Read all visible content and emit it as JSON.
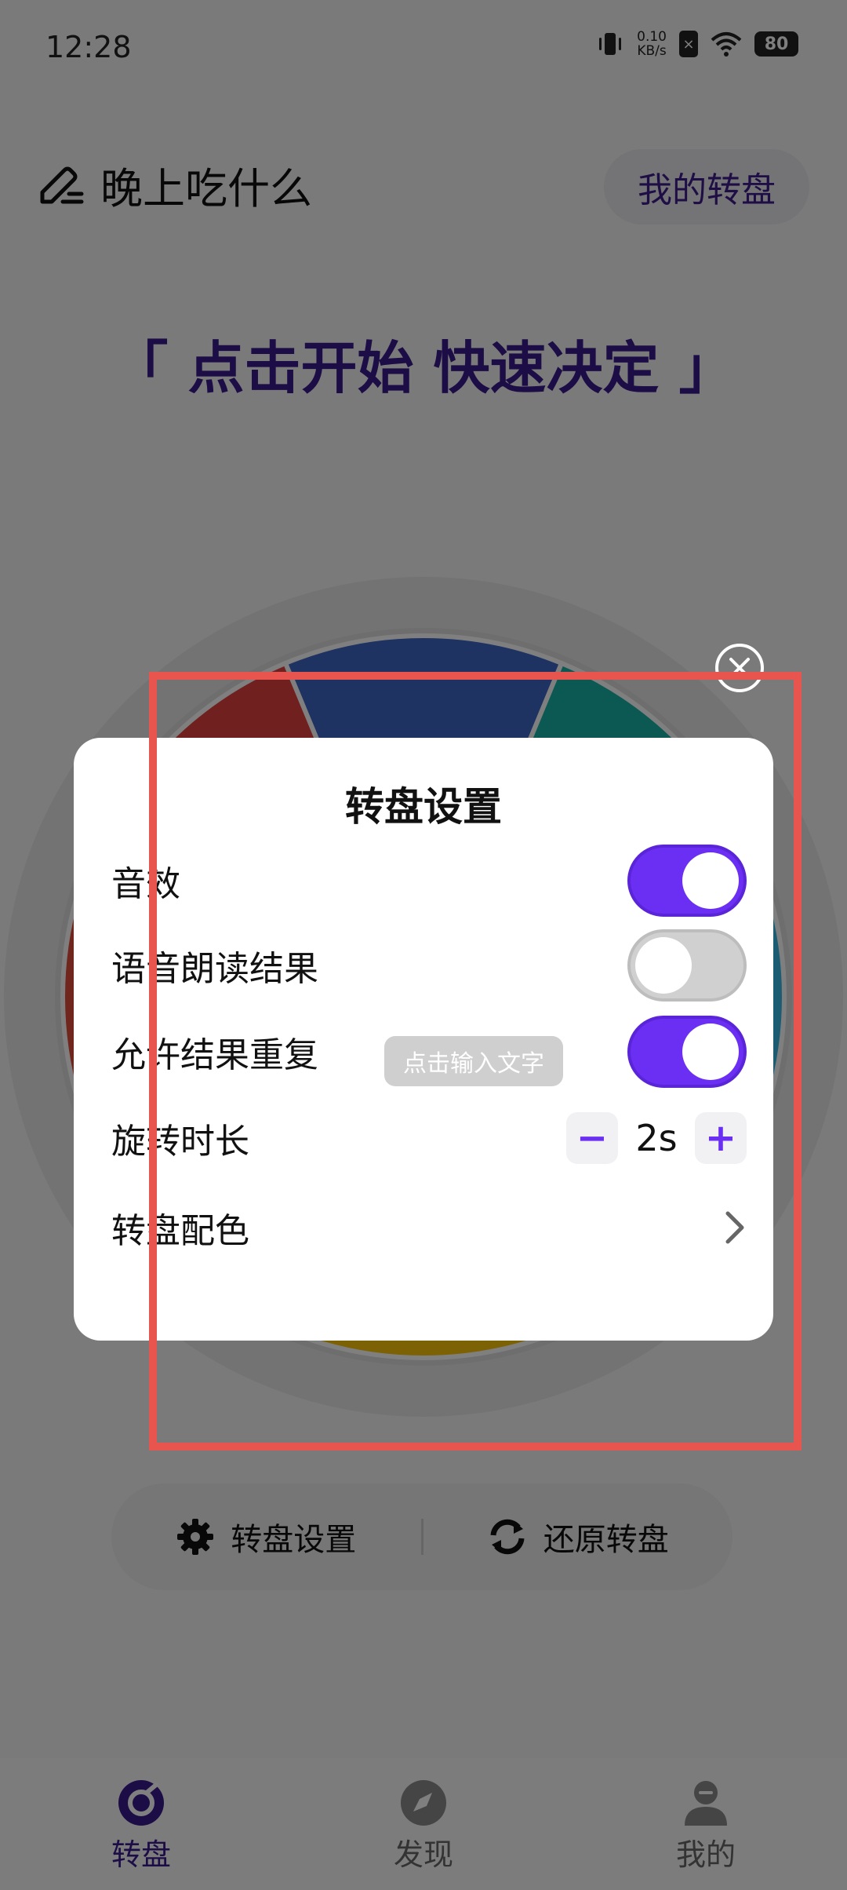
{
  "status_bar": {
    "time": "12:28",
    "net_speed_value": "0.10",
    "net_speed_unit": "KB/s",
    "sim_badge": "×",
    "battery": "80"
  },
  "header": {
    "title": "晚上吃什么",
    "my_wheel_button": "我的转盘"
  },
  "slogan": "「 点击开始 快速决定 」",
  "wheel": {
    "segment_colors": [
      "#3d66c4",
      "#16b3a4",
      "#39b8e6",
      "#9cd62c",
      "#f8c40a",
      "#f08a20",
      "#e04a3b",
      "#e0413e"
    ]
  },
  "toolbar": {
    "settings_label": "转盘设置",
    "reset_label": "还原转盘"
  },
  "tabs": [
    {
      "label": "转盘",
      "active": true
    },
    {
      "label": "发现",
      "active": false
    },
    {
      "label": "我的",
      "active": false
    }
  ],
  "dialog": {
    "title": "转盘设置",
    "sound_label": "音效",
    "sound_on": true,
    "voice_label": "语音朗读结果",
    "voice_on": false,
    "repeat_label": "允许结果重复",
    "repeat_on": true,
    "duration_label": "旋转时长",
    "duration_value": "2s",
    "minus": "−",
    "plus": "+",
    "color_label": "转盘配色",
    "input_chip": "点击输入文字"
  },
  "colors": {
    "accent": "#6a2ff2",
    "title_purple": "#3a1a8c",
    "highlight_red": "#e8554f"
  }
}
